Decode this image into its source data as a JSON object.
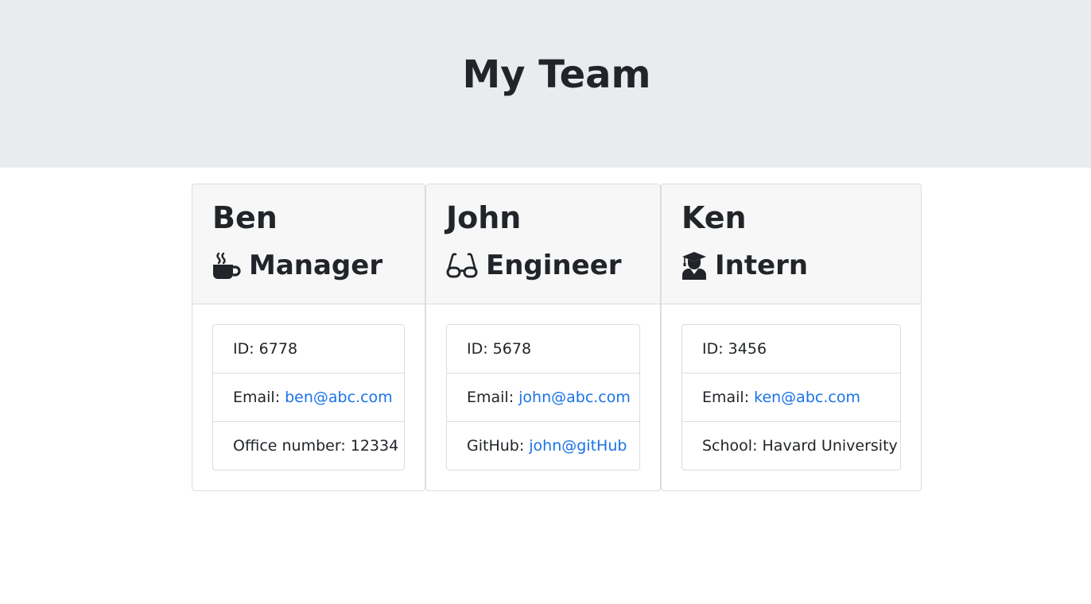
{
  "header": {
    "title": "My Team"
  },
  "team": [
    {
      "name": "Ben",
      "role": "Manager",
      "role_icon": "coffee-mug-icon",
      "id_text": "ID: 6778",
      "email_label": "Email:",
      "email": "ben@abc.com",
      "extra_label": "Office number: 12334",
      "extra_link": ""
    },
    {
      "name": "John",
      "role": "Engineer",
      "role_icon": "glasses-icon",
      "id_text": "ID: 5678",
      "email_label": "Email:",
      "email": "john@abc.com",
      "extra_label": "GitHub:",
      "extra_link": "john@gitHub"
    },
    {
      "name": "Ken",
      "role": "Intern",
      "role_icon": "graduate-icon",
      "id_text": "ID: 3456",
      "email_label": "Email:",
      "email": "ken@abc.com",
      "extra_label": "School: Havard University",
      "extra_link": ""
    }
  ],
  "colors": {
    "link": "#1a73e8",
    "jumbotron": "#e9ecef",
    "text": "#212529"
  }
}
